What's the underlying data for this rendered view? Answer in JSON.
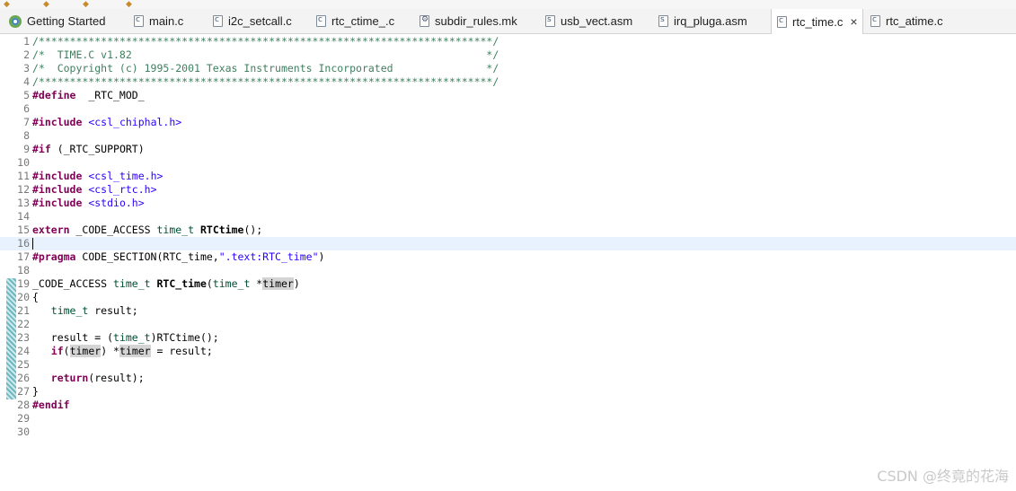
{
  "tabs": [
    {
      "label": "Getting Started",
      "icon": "welcome-icon",
      "active": false
    },
    {
      "label": "main.c",
      "icon": "c-file-icon",
      "active": false
    },
    {
      "label": "i2c_setcall.c",
      "icon": "c-file-icon",
      "active": false
    },
    {
      "label": "rtc_ctime_.c",
      "icon": "c-file-icon",
      "active": false
    },
    {
      "label": "subdir_rules.mk",
      "icon": "makefile-icon",
      "active": false
    },
    {
      "label": "usb_vect.asm",
      "icon": "asm-file-icon",
      "active": false
    },
    {
      "label": "irq_pluga.asm",
      "icon": "asm-file-icon",
      "active": false
    },
    {
      "label": "rtc_time.c",
      "icon": "c-file-icon",
      "active": true,
      "close": "×"
    },
    {
      "label": "rtc_atime.c",
      "icon": "c-file-icon",
      "active": false
    }
  ],
  "lines": [
    {
      "n": "1",
      "segs": [
        [
          "cm",
          "/*************************************************************************/"
        ]
      ]
    },
    {
      "n": "2",
      "segs": [
        [
          "cm",
          "/*  TIME.C v1.82                                                         */"
        ]
      ]
    },
    {
      "n": "3",
      "segs": [
        [
          "cm",
          "/*  Copyright (c) 1995-2001 Texas Instruments Incorporated               */"
        ]
      ]
    },
    {
      "n": "4",
      "segs": [
        [
          "cm",
          "/*************************************************************************/"
        ]
      ]
    },
    {
      "n": "5",
      "segs": [
        [
          "kw",
          "#define"
        ],
        [
          "",
          "  _RTC_MOD_"
        ]
      ]
    },
    {
      "n": "6",
      "segs": []
    },
    {
      "n": "7",
      "segs": [
        [
          "kw",
          "#include"
        ],
        [
          "",
          " "
        ],
        [
          "str",
          "<csl_chiphal.h>"
        ]
      ]
    },
    {
      "n": "8",
      "segs": []
    },
    {
      "n": "9",
      "segs": [
        [
          "kw",
          "#if"
        ],
        [
          "",
          " (_RTC_SUPPORT)"
        ]
      ]
    },
    {
      "n": "10",
      "segs": []
    },
    {
      "n": "11",
      "segs": [
        [
          "kw",
          "#include"
        ],
        [
          "",
          " "
        ],
        [
          "str",
          "<csl_time.h>"
        ]
      ]
    },
    {
      "n": "12",
      "segs": [
        [
          "kw",
          "#include"
        ],
        [
          "",
          " "
        ],
        [
          "str",
          "<csl_rtc.h>"
        ]
      ]
    },
    {
      "n": "13",
      "segs": [
        [
          "kw",
          "#include"
        ],
        [
          "",
          " "
        ],
        [
          "str",
          "<stdio.h>"
        ]
      ]
    },
    {
      "n": "14",
      "segs": []
    },
    {
      "n": "15",
      "segs": [
        [
          "kw",
          "extern"
        ],
        [
          "",
          " _CODE_ACCESS "
        ],
        [
          "ty",
          "time_t"
        ],
        [
          "",
          " "
        ],
        [
          "fn",
          "RTCtime"
        ],
        [
          "",
          "();"
        ]
      ]
    },
    {
      "n": "16",
      "segs": [],
      "current": true
    },
    {
      "n": "17",
      "segs": [
        [
          "kw",
          "#pragma"
        ],
        [
          "",
          " CODE_SECTION(RTC_time,"
        ],
        [
          "str",
          "\".text:RTC_time\""
        ],
        [
          "",
          ")"
        ]
      ]
    },
    {
      "n": "18",
      "segs": []
    },
    {
      "n": "19",
      "segs": [
        [
          "",
          "_CODE_ACCESS "
        ],
        [
          "ty",
          "time_t"
        ],
        [
          "",
          " "
        ],
        [
          "fn",
          "RTC_time"
        ],
        [
          "",
          "("
        ],
        [
          "ty",
          "time_t"
        ],
        [
          "",
          " *"
        ],
        [
          "hl",
          "timer"
        ],
        [
          "",
          ")"
        ]
      ]
    },
    {
      "n": "20",
      "segs": [
        [
          "",
          "{"
        ]
      ]
    },
    {
      "n": "21",
      "segs": [
        [
          "",
          "   "
        ],
        [
          "ty",
          "time_t"
        ],
        [
          "",
          " result;"
        ]
      ]
    },
    {
      "n": "22",
      "segs": []
    },
    {
      "n": "23",
      "segs": [
        [
          "",
          "   result = ("
        ],
        [
          "ty",
          "time_t"
        ],
        [
          "",
          ")RTCtime();"
        ]
      ]
    },
    {
      "n": "24",
      "segs": [
        [
          "",
          "   "
        ],
        [
          "kw",
          "if"
        ],
        [
          "",
          "("
        ],
        [
          "hl",
          "timer"
        ],
        [
          "",
          ") *"
        ],
        [
          "hl",
          "timer"
        ],
        [
          "",
          " = result;"
        ]
      ]
    },
    {
      "n": "25",
      "segs": []
    },
    {
      "n": "26",
      "segs": [
        [
          "",
          "   "
        ],
        [
          "kw",
          "return"
        ],
        [
          "",
          "(result);"
        ]
      ]
    },
    {
      "n": "27",
      "segs": [
        [
          "",
          "}"
        ]
      ]
    },
    {
      "n": "28",
      "segs": [
        [
          "kw",
          "#endif"
        ]
      ]
    },
    {
      "n": "29",
      "segs": []
    },
    {
      "n": "30",
      "segs": []
    }
  ],
  "watermark": "CSDN @终竟的花海"
}
